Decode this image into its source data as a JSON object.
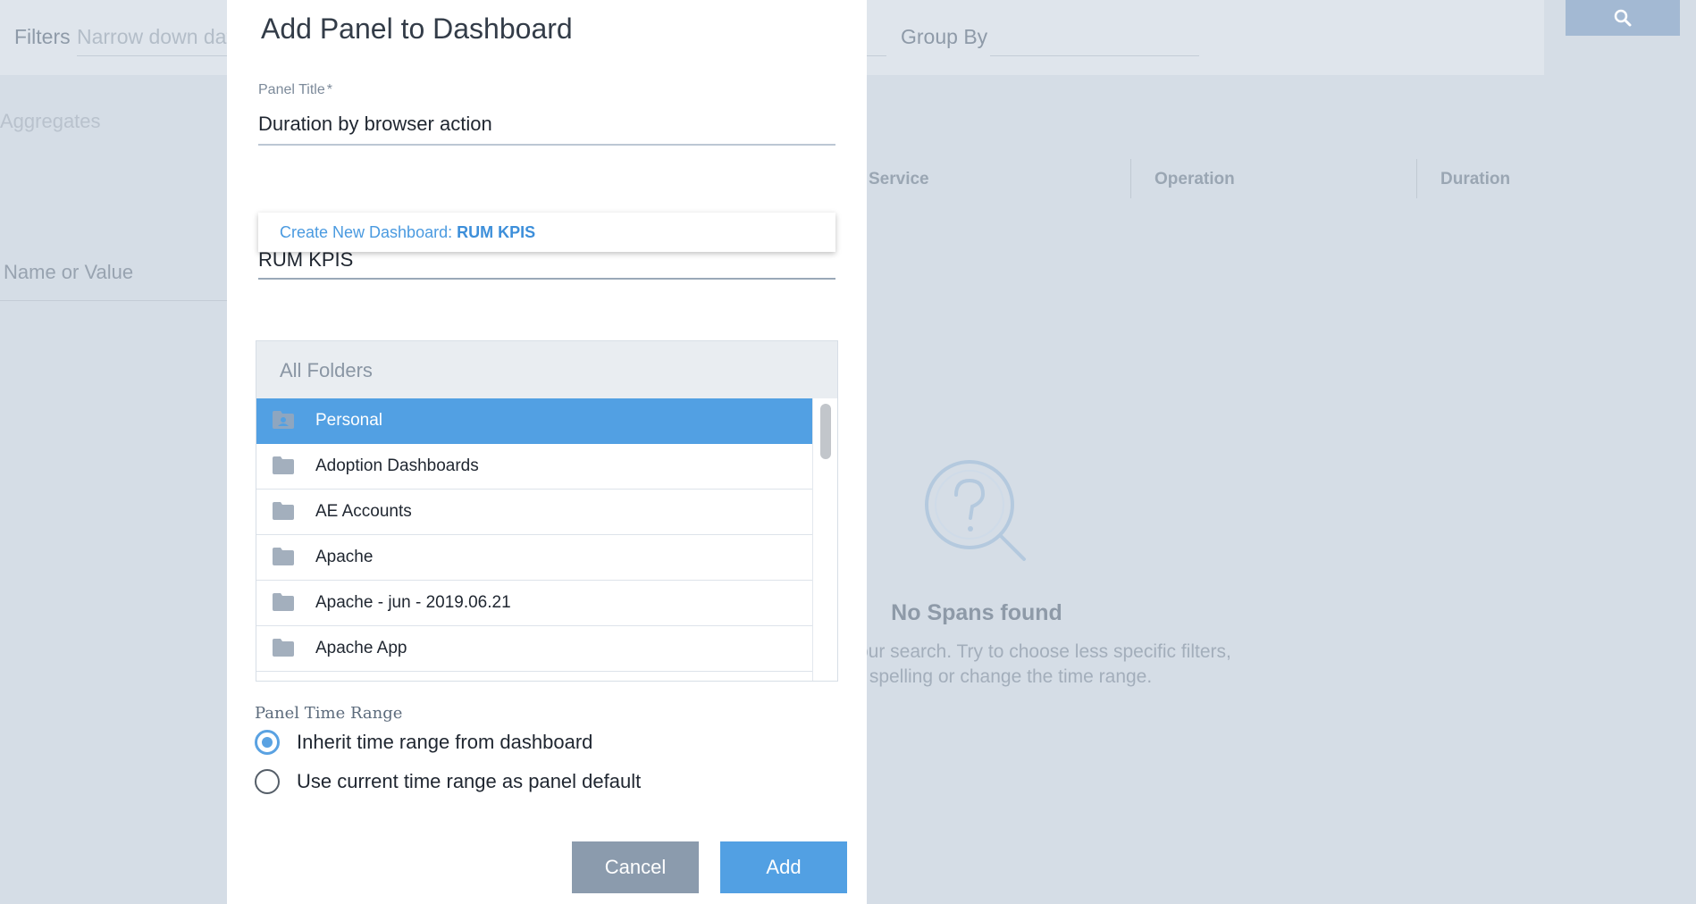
{
  "background": {
    "filters_label": "Filters",
    "filters_placeholder": "Narrow down dat",
    "group_by_label": "Group By",
    "aggregates_label": "Aggregates",
    "name_or_value_placeholder": "Name or Value",
    "columns": [
      "Service",
      "Operation",
      "Duration"
    ],
    "empty_title": "No Spans found",
    "empty_line1": "our search. Try to choose less specific filters,",
    "empty_line2": "r spelling or change the time range."
  },
  "modal": {
    "title": "Add Panel to Dashboard",
    "panel_title_label": "Panel Title",
    "required_mark": "*",
    "panel_title_value": "Duration by browser action",
    "suggestion_prefix": "Create New Dashboard: ",
    "suggestion_name": "RUM KPIS",
    "dashboard_value": "RUM KPIS",
    "folders_header": "All Folders",
    "folders": [
      {
        "name": "Personal",
        "icon": "personal-folder-icon",
        "selected": true
      },
      {
        "name": "Adoption Dashboards",
        "icon": "folder-icon",
        "selected": false
      },
      {
        "name": "AE Accounts",
        "icon": "folder-icon",
        "selected": false
      },
      {
        "name": "Apache",
        "icon": "folder-icon",
        "selected": false
      },
      {
        "name": "Apache - jun - 2019.06.21",
        "icon": "folder-icon",
        "selected": false
      },
      {
        "name": "Apache App",
        "icon": "folder-icon",
        "selected": false
      }
    ],
    "time_range_label": "Panel Time Range",
    "time_range_options": [
      {
        "label": "Inherit time range from dashboard",
        "checked": true
      },
      {
        "label": "Use current time range as panel default",
        "checked": false
      }
    ],
    "cancel_label": "Cancel",
    "add_label": "Add"
  },
  "colors": {
    "accent": "#52a0e3",
    "cancel": "#8b9bad",
    "overlay": "#d5dde6"
  }
}
